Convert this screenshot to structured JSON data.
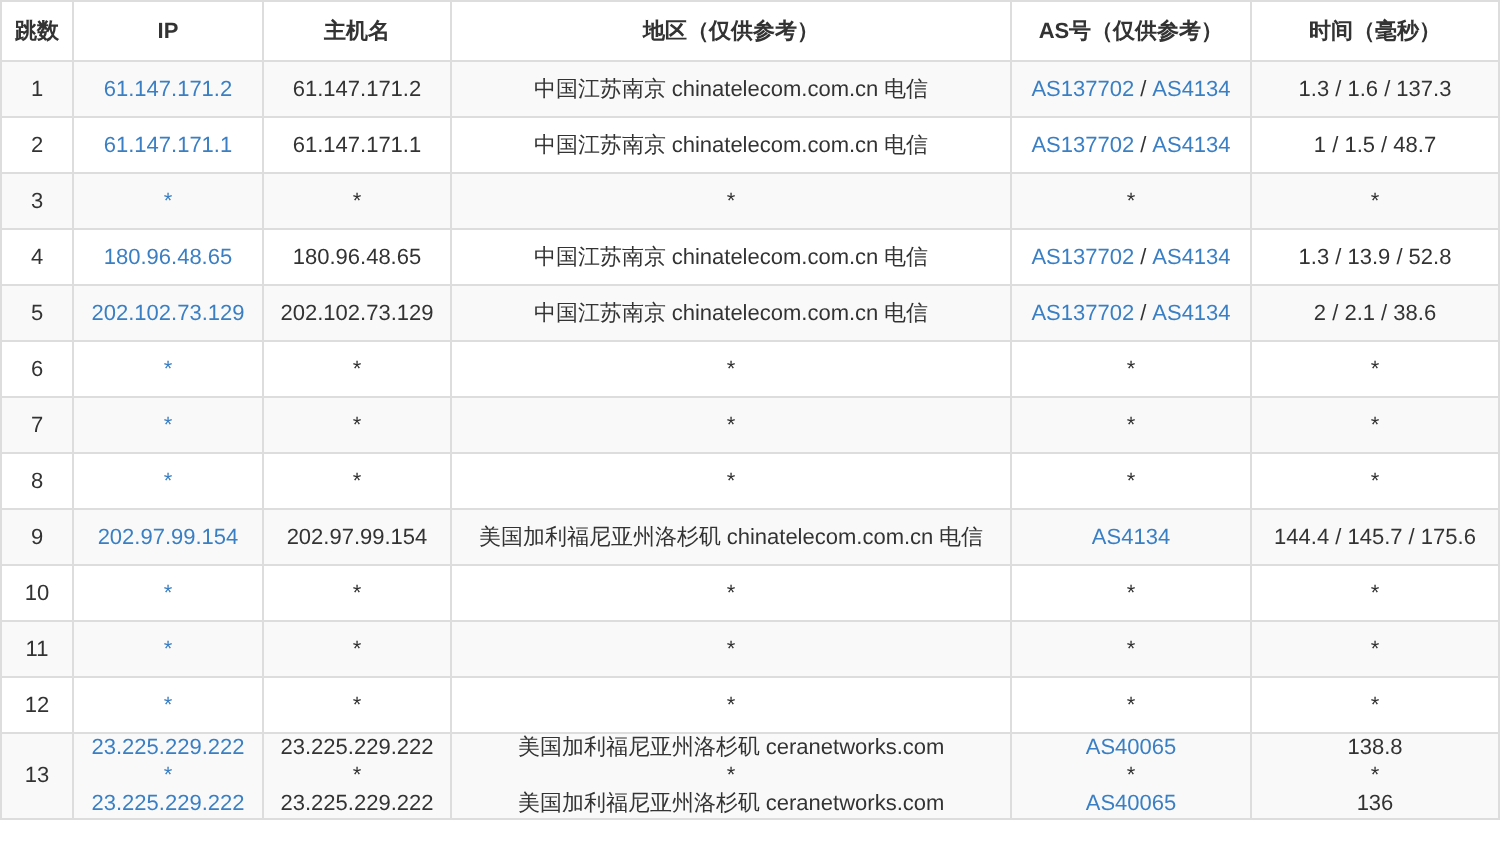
{
  "columns": [
    "跳数",
    "IP",
    "主机名",
    "地区（仅供参考）",
    "AS号（仅供参考）",
    "时间（毫秒）"
  ],
  "rows": [
    {
      "hop": "1",
      "entries": [
        {
          "ip": "61.147.171.2",
          "host": "61.147.171.2",
          "region": "中国江苏南京 chinatelecom.com.cn 电信",
          "as": [
            {
              "kind": "link",
              "text": "AS137702"
            },
            {
              "kind": "sep",
              "text": "/"
            },
            {
              "kind": "link",
              "text": "AS4134"
            }
          ],
          "time": "1.3 / 1.6 / 137.3"
        }
      ]
    },
    {
      "hop": "2",
      "entries": [
        {
          "ip": "61.147.171.1",
          "host": "61.147.171.1",
          "region": "中国江苏南京 chinatelecom.com.cn 电信",
          "as": [
            {
              "kind": "link",
              "text": "AS137702"
            },
            {
              "kind": "sep",
              "text": "/"
            },
            {
              "kind": "link",
              "text": "AS4134"
            }
          ],
          "time": "1 / 1.5 / 48.7"
        }
      ]
    },
    {
      "hop": "3",
      "entries": [
        {
          "ip": "*",
          "host": "*",
          "region": "*",
          "as": [
            {
              "kind": "sep",
              "text": "*"
            }
          ],
          "time": "*"
        }
      ]
    },
    {
      "hop": "4",
      "entries": [
        {
          "ip": "180.96.48.65",
          "host": "180.96.48.65",
          "region": "中国江苏南京 chinatelecom.com.cn 电信",
          "as": [
            {
              "kind": "link",
              "text": "AS137702"
            },
            {
              "kind": "sep",
              "text": "/"
            },
            {
              "kind": "link",
              "text": "AS4134"
            }
          ],
          "time": "1.3 / 13.9 / 52.8"
        }
      ]
    },
    {
      "hop": "5",
      "entries": [
        {
          "ip": "202.102.73.129",
          "host": "202.102.73.129",
          "region": "中国江苏南京 chinatelecom.com.cn 电信",
          "as": [
            {
              "kind": "link",
              "text": "AS137702"
            },
            {
              "kind": "sep",
              "text": "/"
            },
            {
              "kind": "link",
              "text": "AS4134"
            }
          ],
          "time": "2 / 2.1 / 38.6"
        }
      ]
    },
    {
      "hop": "6",
      "entries": [
        {
          "ip": "*",
          "host": "*",
          "region": "*",
          "as": [
            {
              "kind": "sep",
              "text": "*"
            }
          ],
          "time": "*"
        }
      ]
    },
    {
      "hop": "7",
      "entries": [
        {
          "ip": "*",
          "host": "*",
          "region": "*",
          "as": [
            {
              "kind": "sep",
              "text": "*"
            }
          ],
          "time": "*"
        }
      ]
    },
    {
      "hop": "8",
      "entries": [
        {
          "ip": "*",
          "host": "*",
          "region": "*",
          "as": [
            {
              "kind": "sep",
              "text": "*"
            }
          ],
          "time": "*"
        }
      ]
    },
    {
      "hop": "9",
      "entries": [
        {
          "ip": "202.97.99.154",
          "host": "202.97.99.154",
          "region": "美国加利福尼亚州洛杉矶 chinatelecom.com.cn 电信",
          "as": [
            {
              "kind": "link",
              "text": "AS4134"
            }
          ],
          "time": "144.4 / 145.7 / 175.6"
        }
      ]
    },
    {
      "hop": "10",
      "entries": [
        {
          "ip": "*",
          "host": "*",
          "region": "*",
          "as": [
            {
              "kind": "sep",
              "text": "*"
            }
          ],
          "time": "*"
        }
      ]
    },
    {
      "hop": "11",
      "entries": [
        {
          "ip": "*",
          "host": "*",
          "region": "*",
          "as": [
            {
              "kind": "sep",
              "text": "*"
            }
          ],
          "time": "*"
        }
      ]
    },
    {
      "hop": "12",
      "entries": [
        {
          "ip": "*",
          "host": "*",
          "region": "*",
          "as": [
            {
              "kind": "sep",
              "text": "*"
            }
          ],
          "time": "*"
        }
      ]
    },
    {
      "hop": "13",
      "entries": [
        {
          "ip": "23.225.229.222",
          "host": "23.225.229.222",
          "region": "美国加利福尼亚州洛杉矶 ceranetworks.com",
          "as": [
            {
              "kind": "link",
              "text": "AS40065"
            }
          ],
          "time": "138.8"
        },
        {
          "ip": "*",
          "host": "*",
          "region": "*",
          "as": [
            {
              "kind": "sep",
              "text": "*"
            }
          ],
          "time": "*"
        },
        {
          "ip": "23.225.229.222",
          "host": "23.225.229.222",
          "region": "美国加利福尼亚州洛杉矶 ceranetworks.com",
          "as": [
            {
              "kind": "link",
              "text": "AS40065"
            }
          ],
          "time": "136"
        }
      ]
    }
  ]
}
